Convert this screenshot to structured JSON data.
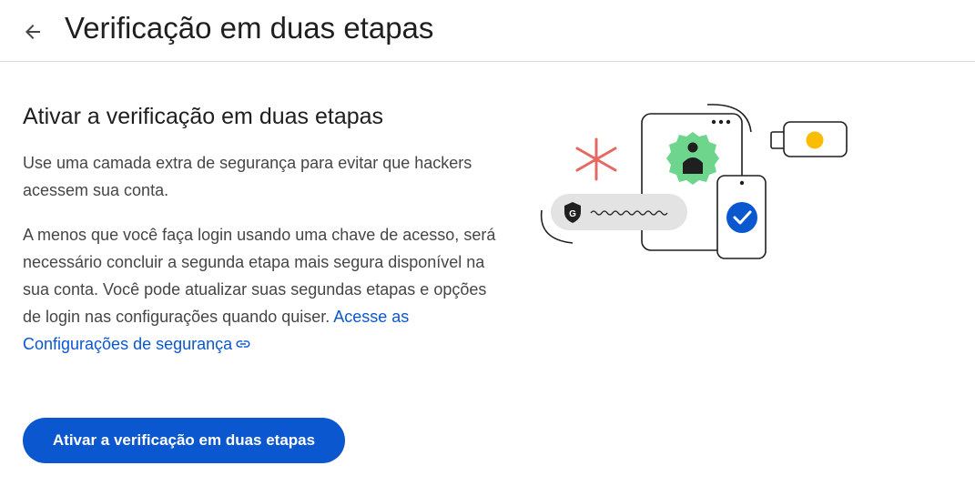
{
  "header": {
    "back_icon": "arrow-back-icon",
    "title": "Verificação em duas etapas"
  },
  "section": {
    "title": "Ativar a verificação em duas etapas",
    "paragraph1": "Use uma camada extra de segurança para evitar que hackers acessem sua conta.",
    "paragraph2": "A menos que você faça login usando uma chave de acesso, será necessário concluir a segunda etapa mais segura disponível na sua conta. Você pode atualizar suas segundas etapas e opções de login nas configurações quando quiser.",
    "link_text": "Acesse as Configurações de segurança",
    "link_icon": "link-icon",
    "button_label": "Ativar a verificação em duas etapas"
  },
  "illustration": {
    "google_badge_letter": "G",
    "icons": [
      "asterisk-icon",
      "person-badge-icon",
      "security-key-icon",
      "check-circle-icon",
      "google-shield-icon"
    ]
  },
  "colors": {
    "primary": "#0b57d0",
    "link": "#0b57d0",
    "badge_green": "#6dd58c",
    "asterisk_red": "#e46962",
    "key_yellow": "#fbbc04"
  }
}
